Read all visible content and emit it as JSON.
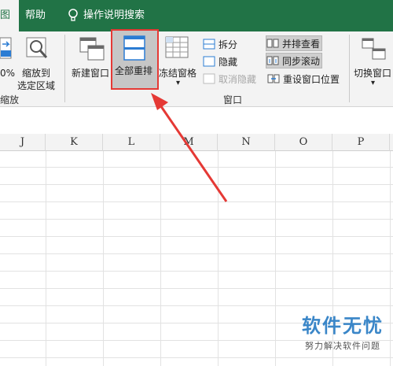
{
  "tabs": {
    "active_partial": "图",
    "help": "帮助",
    "tell_me": "操作说明搜索"
  },
  "ribbon": {
    "zoom_value": "0%",
    "zoom_to_selection_line1": "缩放到",
    "zoom_to_selection_line2": "选定区域",
    "zoom_group_partial": "缩放",
    "new_window": "新建窗口",
    "arrange_all": "全部重排",
    "freeze_panes": "冻结窗格",
    "split": "拆分",
    "hide": "隐藏",
    "unhide": "取消隐藏",
    "view_side_by_side": "并排查看",
    "sync_scrolling": "同步滚动",
    "reset_window_position": "重设窗口位置",
    "switch_windows": "切换窗口",
    "window_group": "窗口",
    "dropdown_glyph": "▾"
  },
  "columns": [
    "J",
    "K",
    "L",
    "M",
    "N",
    "O",
    "P"
  ],
  "watermark": {
    "main": "软件无忧",
    "sub": "努力解决软件问题"
  },
  "colors": {
    "title_green": "#217346",
    "highlight_red": "#e53935",
    "watermark_blue": "#3a86c8"
  }
}
